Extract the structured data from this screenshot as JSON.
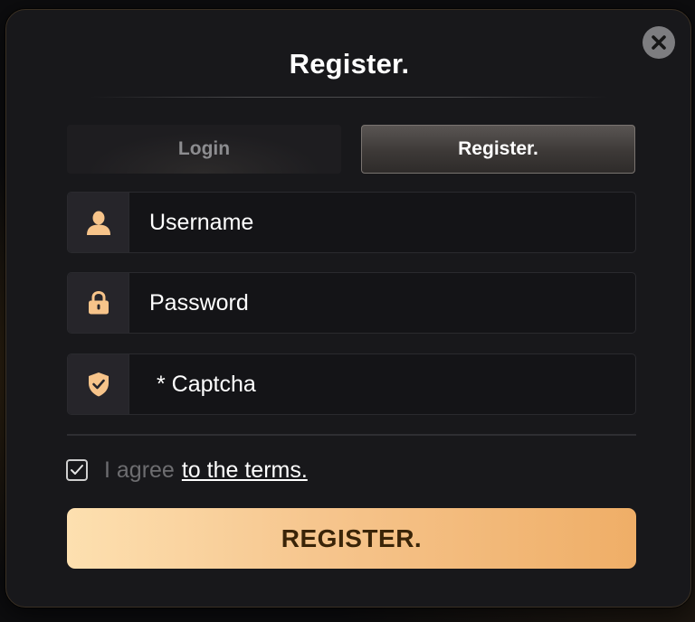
{
  "modal": {
    "title": "Register.",
    "close_icon": "close-icon"
  },
  "tabs": [
    {
      "label": "Login",
      "active": false
    },
    {
      "label": "Register.",
      "active": true
    }
  ],
  "fields": {
    "username": {
      "placeholder": "Username",
      "value": "",
      "icon": "user-icon"
    },
    "password": {
      "placeholder": "Password",
      "value": "",
      "icon": "lock-icon"
    },
    "captcha": {
      "placeholder": "* Captcha",
      "value": "",
      "icon": "shield-check-icon"
    }
  },
  "agreement": {
    "checked": true,
    "text": "I agree",
    "link_text": "to the terms."
  },
  "submit": {
    "label": "REGISTER."
  },
  "colors": {
    "modal_bg": "#18181b",
    "accent_gold": "#f6c58d",
    "icon_gold": "#f7c48a",
    "button_text": "#3a2408",
    "close_bg": "#7d7d80"
  }
}
